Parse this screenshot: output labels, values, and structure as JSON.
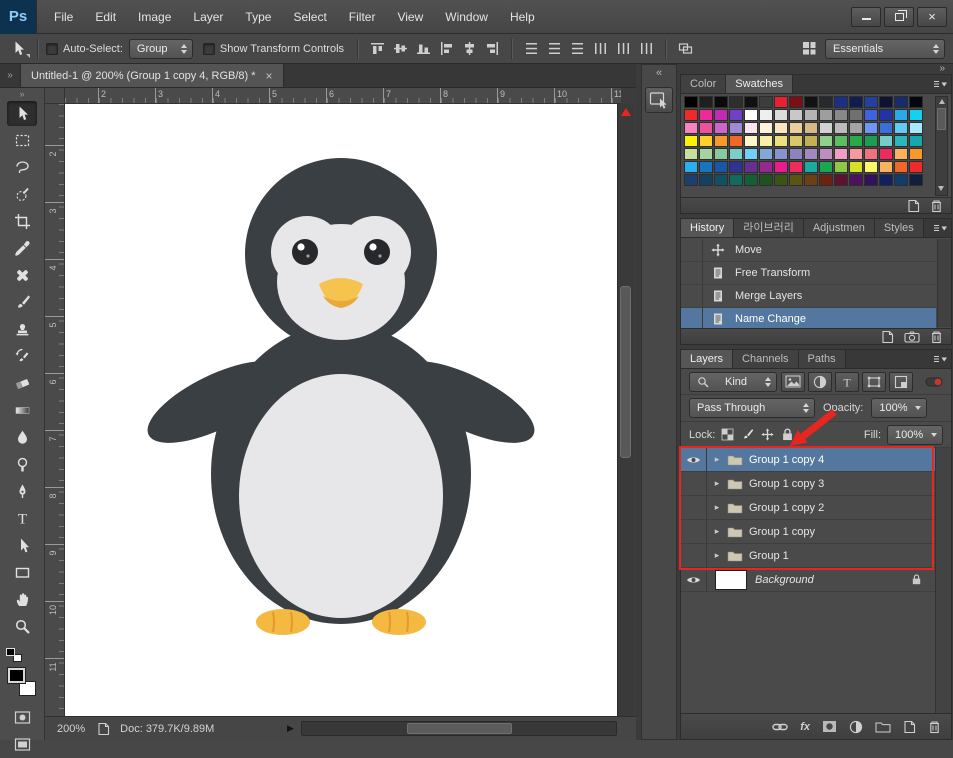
{
  "colors": {
    "selection": "#53779e",
    "annotation": "#e8251f",
    "canvas_bg": "#ffffff"
  },
  "menubar": {
    "logo": "Ps",
    "menus": [
      "File",
      "Edit",
      "Image",
      "Layer",
      "Type",
      "Select",
      "Filter",
      "View",
      "Window",
      "Help"
    ],
    "window_controls": [
      "minimize",
      "restore-down",
      "close"
    ]
  },
  "options": {
    "tool_indicator": "move",
    "auto_select_label": "Auto-Select:",
    "auto_select_checked": false,
    "auto_select_mode": "Group",
    "show_transform_label": "Show Transform Controls",
    "show_transform_checked": false,
    "align_icons": [
      "align-top-edges",
      "align-vertical-centers",
      "align-bottom-edges",
      "align-left-edges",
      "align-horizontal-centers",
      "align-right-edges"
    ],
    "distribute_icons": [
      "distribute-top-edges",
      "distribute-vertical-centers",
      "distribute-bottom-edges",
      "distribute-left-edges",
      "distribute-horizontal-centers",
      "distribute-right-edges"
    ],
    "extra_icons": [
      "auto-align-layers"
    ],
    "workspace_label": "Essentials"
  },
  "tabbar": {
    "title": "Untitled-1 @ 200% (Group 1 copy 4, RGB/8) *",
    "close_glyph": "×"
  },
  "tools": [
    "move",
    "rectangular-marquee",
    "lasso",
    "quick-selection",
    "crop",
    "eyedropper",
    "spot-healing-brush",
    "brush",
    "clone-stamp",
    "history-brush",
    "eraser",
    "gradient",
    "blur",
    "dodge",
    "pen",
    "horizontal-type",
    "path-selection",
    "rectangle",
    "hand",
    "zoom"
  ],
  "active_tool": "move",
  "foreground_color": "#000000",
  "background_color": "#ffffff",
  "rulers": {
    "horizontal": [
      "2",
      "3",
      "4",
      "5",
      "6",
      "7",
      "8",
      "9",
      "10",
      "11"
    ],
    "vertical": [
      "2",
      "3",
      "4",
      "5",
      "6",
      "7",
      "8",
      "9",
      "10",
      "11"
    ]
  },
  "status": {
    "zoom": "200%",
    "doc": "Doc: 379.7K/9.89M"
  },
  "swatches_panel": {
    "tabs": [
      "Color",
      "Swatches"
    ],
    "active_tab": "Swatches",
    "columns": 16,
    "bottom_icons": [
      "new-swatch",
      "delete-swatch"
    ],
    "swatches": [
      "#000000",
      "#1f1f1f",
      "#0a0a0a",
      "#2e2e2e",
      "#111111",
      "#3d3d3d",
      "#e8212e",
      "#7a1016",
      "#121212",
      "#26292e",
      "#1b2f8a",
      "#101d4d",
      "#243f9e",
      "#0d1330",
      "#1a2b6b",
      "#05070f",
      "#ee2a2a",
      "#ec2a9a",
      "#c12ab5",
      "#7040c9",
      "#ffffff",
      "#efefef",
      "#dcdcdc",
      "#c8c8c8",
      "#b4b4b4",
      "#9e9e9e",
      "#888888",
      "#707070",
      "#3f62e0",
      "#2233a8",
      "#2aa9e8",
      "#17d0f0",
      "#f783c4",
      "#f0519e",
      "#cc66cc",
      "#9d8ad2",
      "#fbe3ef",
      "#fdf2dd",
      "#fbe6bd",
      "#eccf9a",
      "#d8b884",
      "#d2d2d2",
      "#bcbcbc",
      "#a4a4a4",
      "#6f96f5",
      "#3a6fd8",
      "#64c9f2",
      "#a5e9fc",
      "#fdf200",
      "#ffd02a",
      "#f79a2a",
      "#f2662a",
      "#fbf6cc",
      "#f7efa5",
      "#ece07f",
      "#d8c866",
      "#c2b052",
      "#8fd08a",
      "#5bbf60",
      "#2aa94a",
      "#1a9e53",
      "#74cdc9",
      "#2ab8bd",
      "#17a8ad",
      "#c6e09d",
      "#a5d49e",
      "#85cb9f",
      "#7dcdc9",
      "#70d0f7",
      "#80a9d9",
      "#8694cb",
      "#8a84bf",
      "#a388bf",
      "#bd8fc0",
      "#f59cc3",
      "#f69a9f",
      "#f3707f",
      "#ee2a5e",
      "#fbb25e",
      "#f7982a",
      "#2aaef0",
      "#1a74bd",
      "#1a56a8",
      "#303394",
      "#682f93",
      "#942a90",
      "#ec1a8e",
      "#ee2a5e",
      "#1aaa9e",
      "#1aa653",
      "#8fc845",
      "#d8e02a",
      "#fdf56a",
      "#fbb25e",
      "#f2662a",
      "#ee2a2a",
      "#1d3f70",
      "#16405f",
      "#125064",
      "#12695d",
      "#126033",
      "#205220",
      "#3b5413",
      "#5d5413",
      "#6c4012",
      "#6c2212",
      "#5d1230",
      "#4e125d",
      "#30125d",
      "#12215d",
      "#123c6c",
      "#0f1f3d"
    ]
  },
  "history_panel": {
    "tabs": [
      "History",
      "라이브러리",
      "Adjustmen",
      "Styles"
    ],
    "active_tab": "History",
    "items": [
      {
        "label": "Move",
        "icon": "move-state",
        "selected": false
      },
      {
        "label": "Free Transform",
        "icon": "transform-state",
        "selected": false
      },
      {
        "label": "Merge Layers",
        "icon": "merge-state",
        "selected": false
      },
      {
        "label": "Name Change",
        "icon": "rename-state",
        "selected": true
      }
    ],
    "bottom_icons": [
      "new-document-from-state",
      "new-snapshot",
      "delete-state"
    ]
  },
  "layers_panel": {
    "tabs": [
      "Layers",
      "Channels",
      "Paths"
    ],
    "active_tab": "Layers",
    "kind_filter": "Kind",
    "filter_icons": [
      "pixel-layer-filter",
      "adjustment-layer-filter",
      "type-layer-filter",
      "shape-layer-filter",
      "smart-object-filter"
    ],
    "blend_mode": "Pass Through",
    "opacity_label": "Opacity:",
    "opacity_value": "100%",
    "lock_label": "Lock:",
    "lock_icons": [
      "lock-transparent-pixels",
      "lock-image-pixels",
      "lock-position",
      "lock-all"
    ],
    "fill_label": "Fill:",
    "fill_value": "100%",
    "rows": [
      {
        "name": "Group 1 copy 4",
        "type": "group",
        "visible": true,
        "selected": true,
        "locked": false
      },
      {
        "name": "Group 1 copy 3",
        "type": "group",
        "visible": false,
        "selected": false,
        "locked": false
      },
      {
        "name": "Group 1 copy 2",
        "type": "group",
        "visible": false,
        "selected": false,
        "locked": false
      },
      {
        "name": "Group 1 copy",
        "type": "group",
        "visible": false,
        "selected": false,
        "locked": false
      },
      {
        "name": "Group 1",
        "type": "group",
        "visible": false,
        "selected": false,
        "locked": false
      },
      {
        "name": "Background",
        "type": "background",
        "visible": true,
        "selected": false,
        "locked": true
      }
    ],
    "bottom_icons": [
      "link-layers",
      "layer-style",
      "add-layer-mask",
      "new-adjustment-layer",
      "new-group",
      "new-layer",
      "delete-layer"
    ]
  }
}
